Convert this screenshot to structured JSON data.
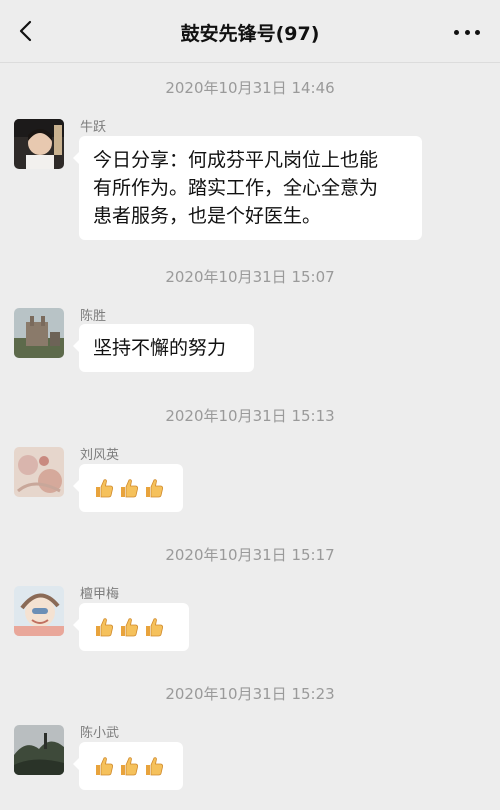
{
  "nav": {
    "title": "鼓安先锋号(97)",
    "back_icon": "chevron-left-icon",
    "more_icon": "more-dots-icon"
  },
  "messages": [
    {
      "timestamp": "2020年10月31日 14:46",
      "sender": "牛跃",
      "text": "今日分享：何成芬平凡岗位上也能有所作为。踏实工作，全心全意为患者服务，也是个好医生。",
      "lines": [
        "今日分享：何成芬平凡岗位上也能",
        "有所作为。踏实工作，全心全意为",
        "患者服务，也是个好医生。"
      ]
    },
    {
      "timestamp": "2020年10月31日 15:07",
      "sender": "陈胜",
      "text": "坚持不懈的努力"
    },
    {
      "timestamp": "2020年10月31日 15:13",
      "sender": "刘风英",
      "emoji": "thumbs-up-icon",
      "emoji_count": 3
    },
    {
      "timestamp": "2020年10月31日 15:17",
      "sender": "檀甲梅",
      "emoji": "thumbs-up-icon",
      "emoji_count": 3
    },
    {
      "timestamp": "2020年10月31日 15:23",
      "sender": "陈小武",
      "emoji": "thumbs-up-icon",
      "emoji_count": 3
    }
  ]
}
